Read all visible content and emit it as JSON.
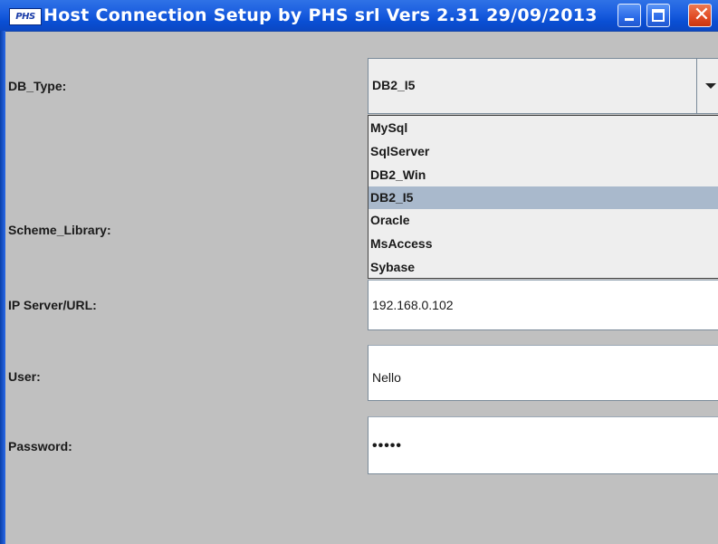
{
  "window": {
    "title": "Host Connection Setup by PHS srl  Vers 2.31  29/09/2013",
    "icon_text": "PHS"
  },
  "form": {
    "db_type_label": "DB_Type:",
    "scheme_label": "Scheme_Library:",
    "ip_label": "IP Server/URL:",
    "user_label": "User:",
    "password_label": "Password:",
    "db_type_value": "DB2_I5",
    "ip_value": "192.168.0.102",
    "user_value": "Nello",
    "password_value": "•••••"
  },
  "dropdown": {
    "options": [
      "MySql",
      "SqlServer",
      "DB2_Win",
      "DB2_I5",
      "Oracle",
      "MsAccess",
      "Sybase"
    ],
    "selected": "DB2_I5"
  },
  "colors": {
    "title_bar": "#0a4fd4",
    "background": "#c0c0c0",
    "selected_option": "#a9b9cc",
    "close_button": "#e04a23"
  }
}
